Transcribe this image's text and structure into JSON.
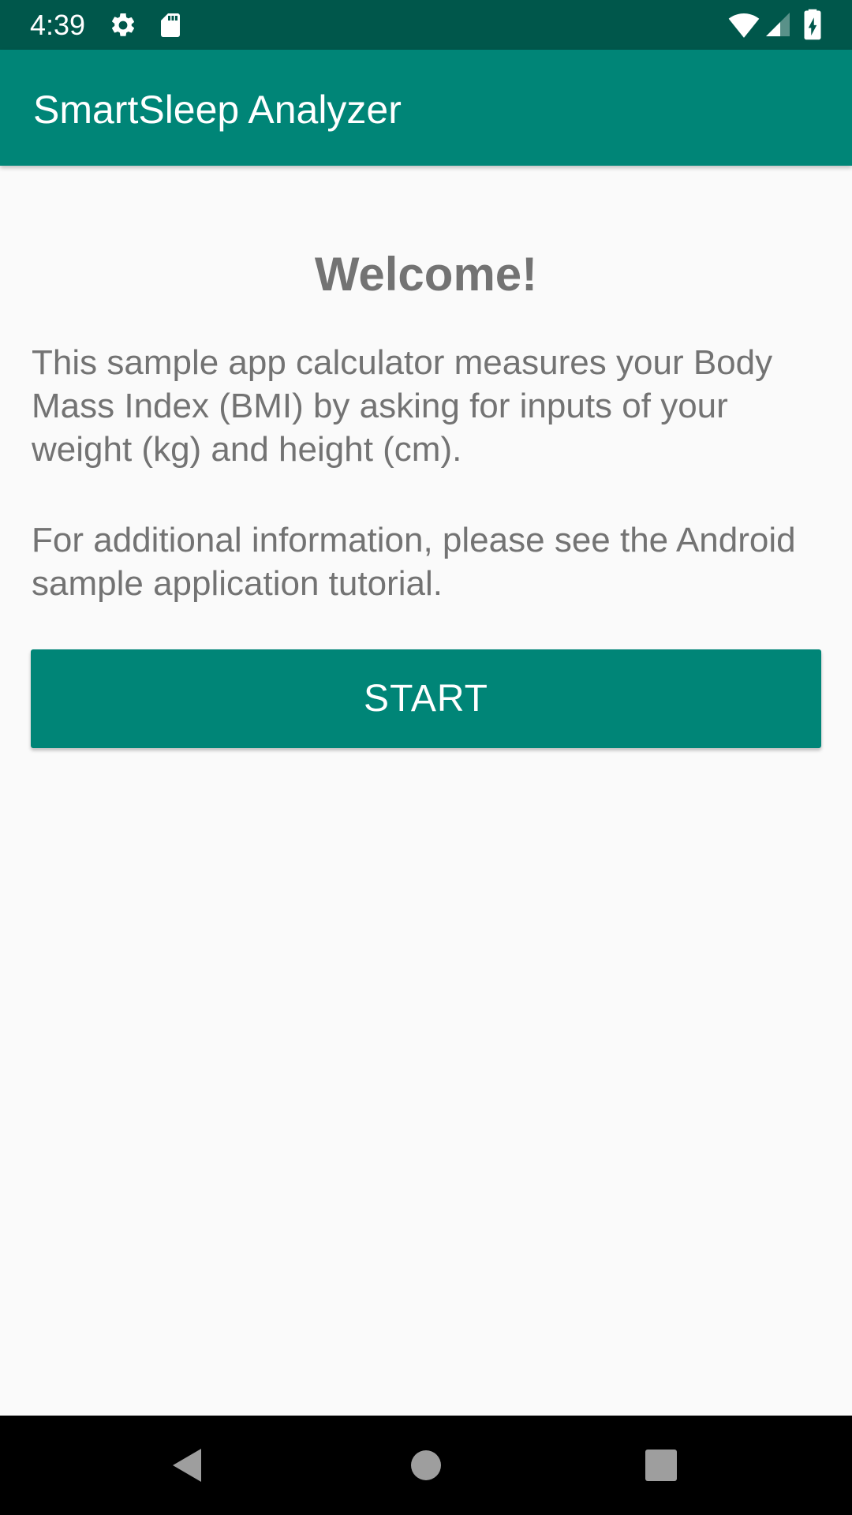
{
  "status_bar": {
    "time": "4:39",
    "icons": [
      "gear-icon",
      "sd-card-icon",
      "wifi-icon",
      "signal-icon",
      "battery-charging-icon"
    ]
  },
  "app_bar": {
    "title": "SmartSleep Analyzer"
  },
  "main": {
    "welcome_title": "Welcome!",
    "paragraph_1": "This sample app calculator measures your Body Mass Index (BMI) by asking for inputs of your weight (kg) and height (cm).",
    "paragraph_2": "For additional information, please see the Android sample application tutorial.",
    "start_button_label": "START"
  },
  "nav_bar": {
    "icons": [
      "back-icon",
      "home-icon",
      "recents-icon"
    ]
  },
  "colors": {
    "status_bar": "#00574b",
    "app_bar": "#008577",
    "accent": "#008577",
    "background": "#fafafa",
    "body_text": "#737373"
  }
}
